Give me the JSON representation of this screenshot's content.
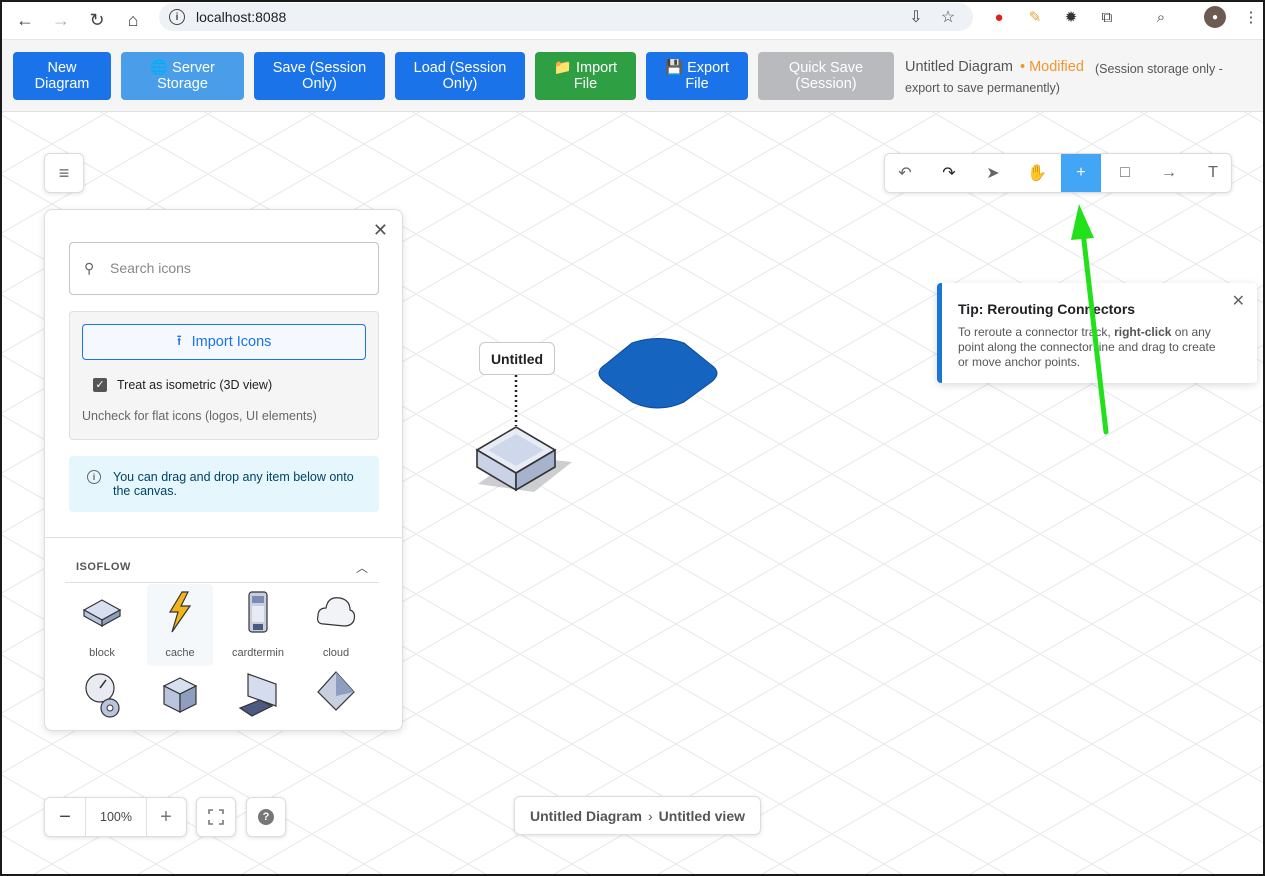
{
  "browser": {
    "url": "localhost:8088"
  },
  "toolbar": {
    "buttons": [
      {
        "label_line1": "New",
        "label_line2": "Diagram"
      },
      {
        "label_line1": "🌐 Server",
        "label_line2": "Storage"
      },
      {
        "label_line1": "Save (Session",
        "label_line2": "Only)"
      },
      {
        "label_line1": "Load (Session",
        "label_line2": "Only)"
      },
      {
        "label_line1": "📁 Import",
        "label_line2": "File"
      },
      {
        "label_line1": "💾 Export",
        "label_line2": "File"
      },
      {
        "label_line1": "Quick Save",
        "label_line2": "(Session)"
      }
    ],
    "diagram_title": "Untitled Diagram",
    "modified": "• Modified",
    "session_note": "(Session storage only - export to save permanently)",
    "colors": {
      "primary": "#1a73e8",
      "server": "#4a9ee9",
      "import": "#2ea043",
      "disabled": "#b8babd",
      "modified": "#f0962b"
    }
  },
  "tools": {
    "items": [
      "undo-icon",
      "redo-icon",
      "select-icon",
      "pan-icon",
      "add-icon",
      "rectangle-icon",
      "connector-icon",
      "text-icon"
    ],
    "active": "add-icon"
  },
  "tip": {
    "title": "Tip: Rerouting Connectors",
    "text_before": "To reroute a connector track, ",
    "text_bold": "right-click",
    "text_after": " on any point along the connector line and drag to create or move anchor points."
  },
  "panel": {
    "search_placeholder": "Search icons",
    "import_button": "Import Icons",
    "treat_isometric": "Treat as isometric (3D view)",
    "treat_isometric_checked": true,
    "uncheck_note": "Uncheck for flat icons (logos, UI elements)",
    "drag_info": "You can drag and drop any item below onto the canvas.",
    "section_title": "ISOFLOW",
    "icons": [
      "block",
      "cache",
      "cardtermin",
      "cloud"
    ]
  },
  "canvas": {
    "node_label": "Untitled"
  },
  "zoom": {
    "value": "100%"
  },
  "breadcrumb": {
    "diagram": "Untitled Diagram",
    "separator": "›",
    "view": "Untitled view"
  }
}
